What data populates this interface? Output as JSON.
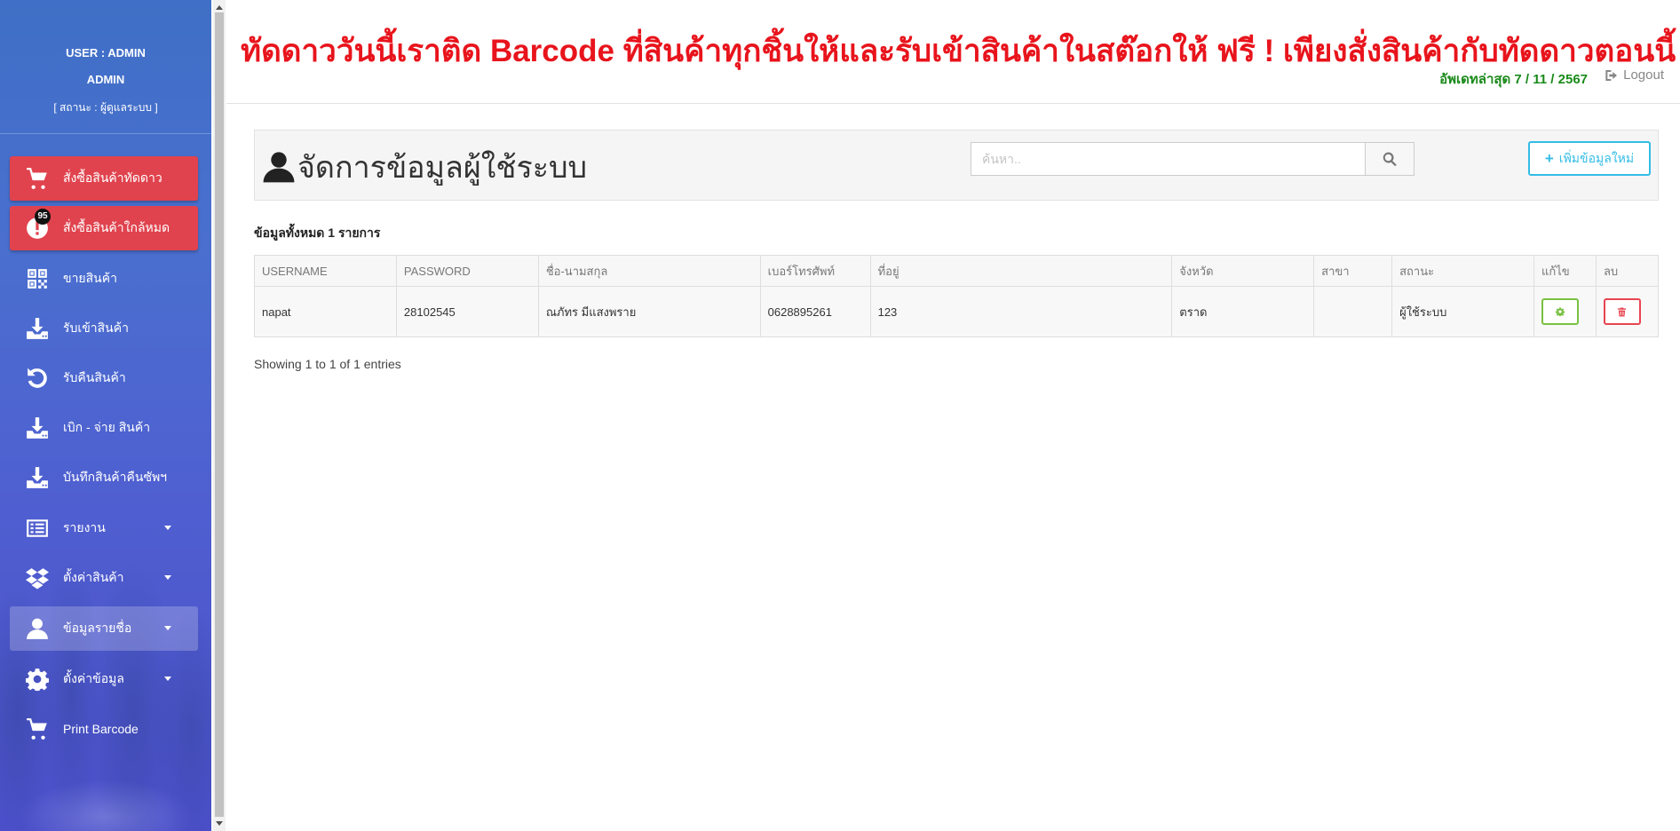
{
  "user": {
    "line1": "USER : ADMIN",
    "line2": "ADMIN",
    "line3": "[ สถานะ : ผู้ดูแลระบบ ]"
  },
  "sidebar": {
    "items": [
      {
        "label": "สั่งซื้อสินค้าทัดดาว",
        "icon": "cart-icon",
        "style": "red"
      },
      {
        "label": "สั่งซื้อสินค้าใกล้หมด",
        "icon": "alert-icon",
        "style": "red",
        "badge": "95"
      },
      {
        "label": "ขายสินค้า",
        "icon": "qrcode-icon"
      },
      {
        "label": "รับเข้าสินค้า",
        "icon": "download-icon"
      },
      {
        "label": "รับคืนสินค้า",
        "icon": "undo-icon"
      },
      {
        "label": "เบิก - จ่าย สินค้า",
        "icon": "download-icon"
      },
      {
        "label": "บันทึกสินค้าคืนซัพฯ",
        "icon": "download-icon"
      },
      {
        "label": "รายงาน",
        "icon": "list-icon",
        "dropdown": true
      },
      {
        "label": "ตั้งค่าสินค้า",
        "icon": "dropbox-icon",
        "dropdown": true
      },
      {
        "label": "ข้อมูลรายชื่อ",
        "icon": "user-icon",
        "dropdown": true,
        "active": true
      },
      {
        "label": "ตั้งค่าข้อมูล",
        "icon": "gear-icon",
        "dropdown": true
      },
      {
        "label": "Print Barcode",
        "icon": "cart-icon"
      }
    ]
  },
  "header": {
    "marquee": "ทัดดาววันนี้เราติด Barcode ที่สินค้าทุกชิ้นให้และรับเข้าสินค้าในสต๊อกให้ ฟรี ! เพียงสั่งสินค้ากับทัดดาวตอนนี้",
    "updated": "อัพเดทล่าสุด 7 / 11 / 2567",
    "logout": "Logout"
  },
  "page": {
    "title": "จัดการข้อมูลผู้ใช้ระบบ",
    "search_placeholder": "ค้นหา..",
    "add_button": "เพิ่มข้อมูลใหม่",
    "total": "ข้อมูลทั้งหมด 1 รายการ",
    "showing": "Showing 1 to 1 of 1 entries"
  },
  "table": {
    "headers": [
      "USERNAME",
      "PASSWORD",
      "ชื่อ-นามสกุล",
      "เบอร์โทรศัพท์",
      "ที่อยู่",
      "จังหวัด",
      "สาขา",
      "สถานะ",
      "แก้ไข",
      "ลบ"
    ],
    "rows": [
      [
        "napat",
        "28102545",
        "ณภัทร มีแสงพราย",
        "0628895261",
        "123",
        "ตราด",
        "",
        "ผู้ใช้ระบบ"
      ]
    ]
  },
  "colors": {
    "accent": "#33bde6",
    "danger": "#e84551",
    "success": "#7ac143",
    "marquee": "#e8141c",
    "sidebar": "#4a6fcf"
  }
}
